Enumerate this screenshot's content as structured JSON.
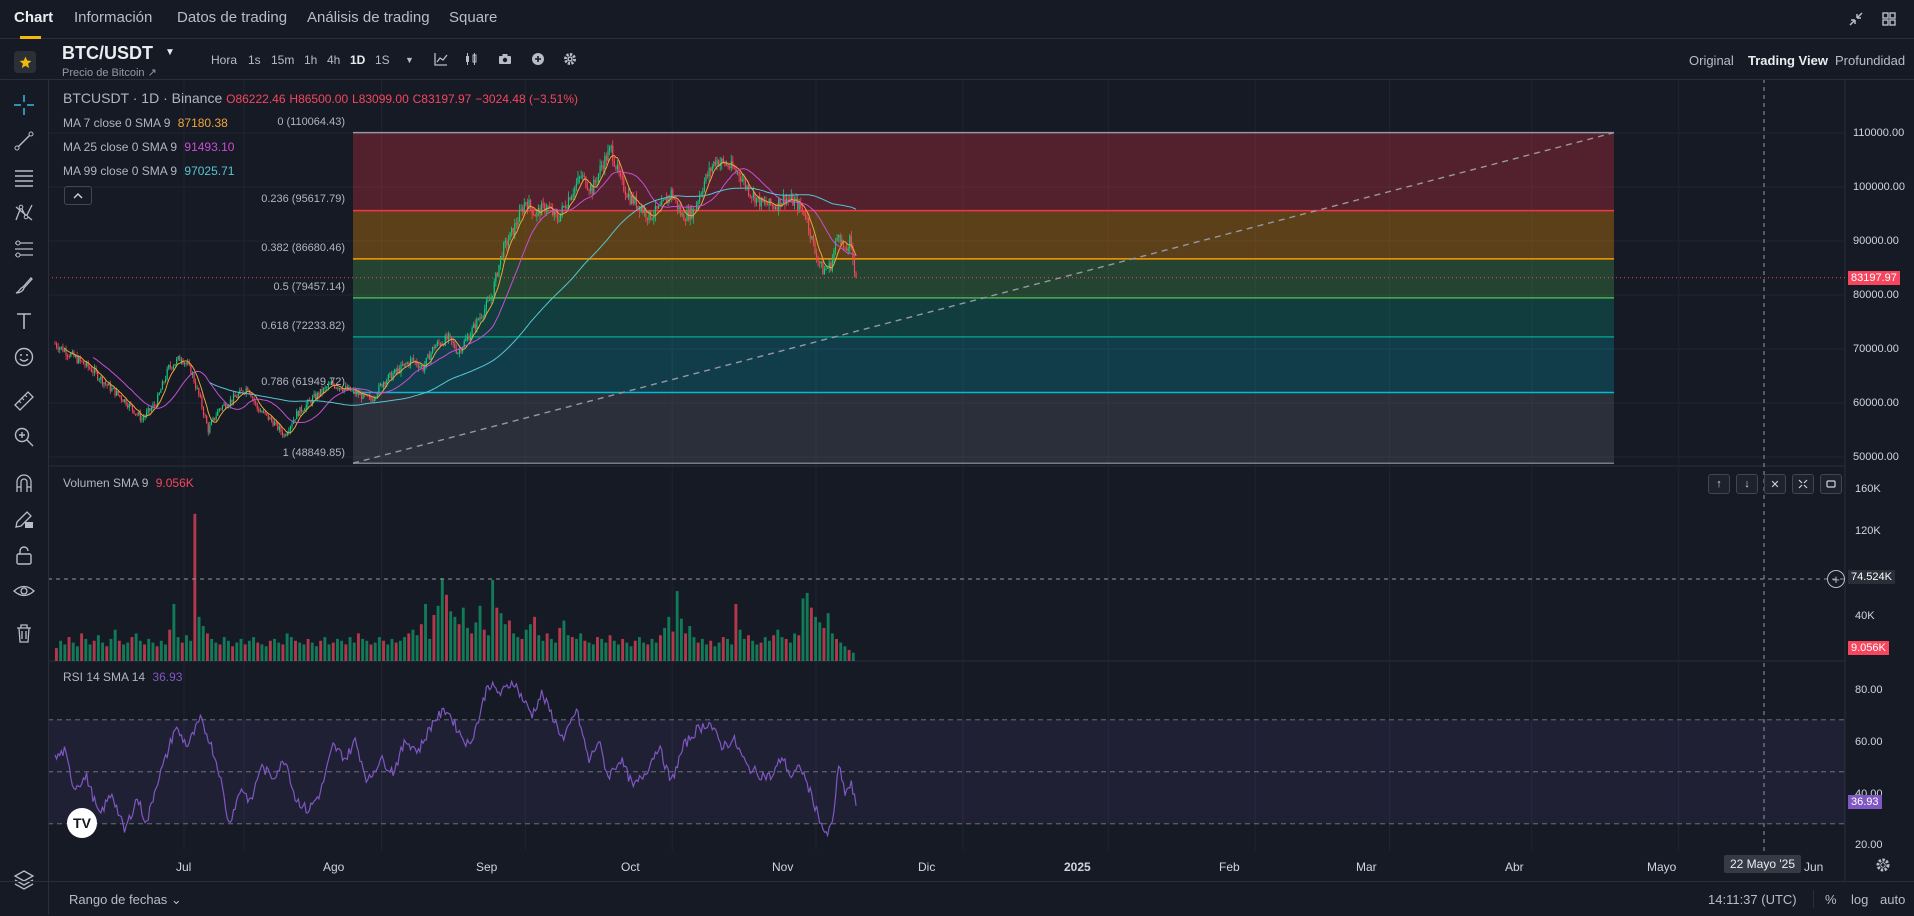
{
  "nav": {
    "tabs": [
      "Chart",
      "Información",
      "Datos de trading",
      "Análisis de trading",
      "Square"
    ]
  },
  "symbol": {
    "pair": "BTC/USDT",
    "subtitle": "Precio de Bitcoin ↗"
  },
  "intervals": [
    "Hora",
    "1s",
    "15m",
    "1h",
    "4h",
    "1D",
    "1S"
  ],
  "active_interval": "1D",
  "views": [
    "Original",
    "Trading View",
    "Profundidad"
  ],
  "active_view": "Trading View",
  "legend": {
    "title": "BTCUSDT · 1D · Binance",
    "open": "O86222.46",
    "high": "H86500.00",
    "low": "L83099.00",
    "close": "C83197.97",
    "change": "−3024.48 (−3.51%)",
    "ma": [
      {
        "label": "MA 7 close 0 SMA 9",
        "value": "87180.38",
        "color": "#f0a43a"
      },
      {
        "label": "MA 25 close 0 SMA 9",
        "value": "91493.10",
        "color": "#c84ed3"
      },
      {
        "label": "MA 99 close 0 SMA 9",
        "value": "97025.71",
        "color": "#56c6d1"
      }
    ]
  },
  "fib": [
    {
      "label": "0 (110064.43)",
      "color": "#9598a1"
    },
    {
      "label": "0.236 (95617.79)",
      "color": "#f23645"
    },
    {
      "label": "0.382 (86680.46)",
      "color": "#ff9800"
    },
    {
      "label": "0.5 (79457.14)",
      "color": "#4caf50"
    },
    {
      "label": "0.618 (72233.82)",
      "color": "#089981"
    },
    {
      "label": "0.786 (61949.72)",
      "color": "#00bcd4"
    },
    {
      "label": "1 (48849.85)",
      "color": "#787b86"
    }
  ],
  "price_axis": [
    "110000.00",
    "100000.00",
    "90000.00",
    "80000.00",
    "70000.00",
    "60000.00",
    "50000.00"
  ],
  "current_price": "83197.97",
  "volume": {
    "label": "Volumen SMA 9",
    "value": "9.056K",
    "axis": [
      "160K",
      "120K",
      "40K"
    ],
    "crosshair_value": "74.524K",
    "current": "9.056K"
  },
  "rsi": {
    "label": "RSI 14 SMA 14",
    "value": "36.93",
    "axis": [
      "80.00",
      "60.00",
      "40.00",
      "20.00"
    ],
    "current": "36.93"
  },
  "time_axis": [
    "Jul",
    "Ago",
    "Sep",
    "Oct",
    "Nov",
    "Dic",
    "2025",
    "Feb",
    "Mar",
    "Abr",
    "Mayo",
    "Jun"
  ],
  "crosshair_date": "22 Mayo '25",
  "footer": {
    "range": "Rango de fechas",
    "clock": "14:11:37 (UTC)",
    "pct": "%",
    "log": "log",
    "auto": "auto"
  },
  "chart_data": {
    "type": "candlestick",
    "title": "BTCUSDT · 1D · Binance",
    "ylim": [
      47000,
      113000
    ],
    "log_scale": false,
    "grid": true,
    "x": [
      "Jul",
      "Ago",
      "Sep",
      "Oct",
      "Nov",
      "Dic",
      "2025",
      "Feb",
      "Mar",
      "Abr",
      "Mayo",
      "Jun"
    ],
    "price_path": [
      [
        0,
        71000
      ],
      [
        12,
        68500
      ],
      [
        24,
        66000
      ],
      [
        34,
        63000
      ],
      [
        44,
        60500
      ],
      [
        55,
        57000
      ],
      [
        64,
        60000
      ],
      [
        72,
        66500
      ],
      [
        80,
        68500
      ],
      [
        86,
        66000
      ],
      [
        92,
        60500
      ],
      [
        97,
        55000
      ],
      [
        104,
        59000
      ],
      [
        114,
        61000
      ],
      [
        122,
        63000
      ],
      [
        128,
        59000
      ],
      [
        138,
        56500
      ],
      [
        145,
        54000
      ],
      [
        153,
        58000
      ],
      [
        164,
        61000
      ],
      [
        175,
        63500
      ],
      [
        185,
        62500
      ],
      [
        193,
        61500
      ],
      [
        200,
        60500
      ],
      [
        208,
        64000
      ],
      [
        217,
        66000
      ],
      [
        226,
        68000
      ],
      [
        233,
        66500
      ],
      [
        240,
        70500
      ],
      [
        249,
        72000
      ],
      [
        255,
        69500
      ],
      [
        262,
        72500
      ],
      [
        270,
        76500
      ],
      [
        276,
        79500
      ],
      [
        283,
        88000
      ],
      [
        290,
        92000
      ],
      [
        298,
        97500
      ],
      [
        304,
        95000
      ],
      [
        311,
        96500
      ],
      [
        318,
        94000
      ],
      [
        325,
        98000
      ],
      [
        333,
        102000
      ],
      [
        340,
        99500
      ],
      [
        346,
        104000
      ],
      [
        352,
        107000
      ],
      [
        358,
        101000
      ],
      [
        364,
        98000
      ],
      [
        370,
        96500
      ],
      [
        376,
        94500
      ],
      [
        383,
        96000
      ],
      [
        390,
        99000
      ],
      [
        397,
        94500
      ],
      [
        404,
        95500
      ],
      [
        411,
        101000
      ],
      [
        418,
        105000
      ],
      [
        426,
        104000
      ],
      [
        433,
        102500
      ],
      [
        440,
        99000
      ],
      [
        447,
        97000
      ],
      [
        455,
        96500
      ],
      [
        462,
        98000
      ],
      [
        469,
        97000
      ],
      [
        475,
        95000
      ],
      [
        481,
        88000
      ],
      [
        486,
        84500
      ],
      [
        491,
        85500
      ],
      [
        496,
        92000
      ],
      [
        500,
        87500
      ],
      [
        503,
        90000
      ],
      [
        507,
        83197.97
      ]
    ],
    "volume_bars_k": [
      14,
      22,
      18,
      26,
      20,
      16,
      30,
      24,
      18,
      22,
      28,
      20,
      16,
      24,
      34,
      22,
      18,
      20,
      26,
      30,
      22,
      18,
      24,
      20,
      16,
      22,
      18,
      34,
      62,
      26,
      20,
      28,
      22,
      160,
      48,
      38,
      30,
      24,
      20,
      18,
      26,
      22,
      16,
      20,
      24,
      18,
      22,
      26,
      20,
      18,
      16,
      22,
      24,
      20,
      18,
      30,
      26,
      22,
      20,
      18,
      24,
      20,
      16,
      22,
      26,
      18,
      20,
      24,
      22,
      18,
      26,
      20,
      30,
      24,
      22,
      18,
      20,
      26,
      22,
      18,
      24,
      20,
      22,
      26,
      30,
      34,
      28,
      40,
      62,
      24,
      50,
      60,
      90,
      72,
      54,
      48,
      40,
      58,
      36,
      30,
      42,
      60,
      34,
      28,
      88,
      58,
      52,
      40,
      44,
      30,
      26,
      24,
      34,
      40,
      48,
      28,
      22,
      30,
      24,
      20,
      36,
      44,
      28,
      26,
      24,
      30,
      22,
      20,
      18,
      26,
      24,
      20,
      28,
      22,
      18,
      24,
      20,
      16,
      22,
      26,
      20,
      18,
      24,
      20,
      28,
      36,
      48,
      32,
      76,
      46,
      30,
      38,
      26,
      20,
      24,
      18,
      22,
      16,
      20,
      26,
      24,
      18,
      62,
      34,
      24,
      28,
      22,
      18,
      20,
      26,
      22,
      28,
      34,
      26,
      24,
      20,
      30,
      28,
      68,
      74,
      58,
      48,
      42,
      36,
      52,
      30,
      24,
      20,
      16,
      12,
      9.056
    ],
    "rsi_path": [
      [
        0,
        55
      ],
      [
        6,
        58
      ],
      [
        12,
        44
      ],
      [
        20,
        48
      ],
      [
        28,
        33
      ],
      [
        36,
        42
      ],
      [
        44,
        27
      ],
      [
        52,
        40
      ],
      [
        58,
        30
      ],
      [
        64,
        45
      ],
      [
        70,
        55
      ],
      [
        76,
        67
      ],
      [
        84,
        60
      ],
      [
        92,
        70
      ],
      [
        98,
        62
      ],
      [
        104,
        50
      ],
      [
        110,
        30
      ],
      [
        118,
        44
      ],
      [
        124,
        38
      ],
      [
        130,
        52
      ],
      [
        138,
        48
      ],
      [
        146,
        55
      ],
      [
        152,
        40
      ],
      [
        160,
        35
      ],
      [
        168,
        42
      ],
      [
        176,
        60
      ],
      [
        184,
        55
      ],
      [
        190,
        62
      ],
      [
        198,
        46
      ],
      [
        206,
        55
      ],
      [
        214,
        50
      ],
      [
        222,
        62
      ],
      [
        230,
        58
      ],
      [
        240,
        70
      ],
      [
        248,
        74
      ],
      [
        256,
        65
      ],
      [
        262,
        60
      ],
      [
        268,
        70
      ],
      [
        274,
        84
      ],
      [
        282,
        80
      ],
      [
        290,
        85
      ],
      [
        296,
        78
      ],
      [
        302,
        72
      ],
      [
        308,
        80
      ],
      [
        316,
        70
      ],
      [
        322,
        62
      ],
      [
        330,
        74
      ],
      [
        338,
        54
      ],
      [
        344,
        62
      ],
      [
        350,
        48
      ],
      [
        358,
        55
      ],
      [
        366,
        44
      ],
      [
        374,
        50
      ],
      [
        382,
        60
      ],
      [
        390,
        46
      ],
      [
        398,
        60
      ],
      [
        406,
        66
      ],
      [
        414,
        69
      ],
      [
        422,
        60
      ],
      [
        430,
        62
      ],
      [
        438,
        52
      ],
      [
        446,
        49
      ],
      [
        454,
        48
      ],
      [
        460,
        56
      ],
      [
        466,
        48
      ],
      [
        472,
        52
      ],
      [
        478,
        42
      ],
      [
        484,
        32
      ],
      [
        488,
        25
      ],
      [
        492,
        30
      ],
      [
        496,
        52
      ],
      [
        500,
        42
      ],
      [
        504,
        45
      ],
      [
        507,
        36.93
      ]
    ],
    "indicators": [
      {
        "name": "MA 7",
        "value": 87180.38
      },
      {
        "name": "MA 25",
        "value": 91493.1
      },
      {
        "name": "MA 99",
        "value": 97025.71
      }
    ]
  }
}
